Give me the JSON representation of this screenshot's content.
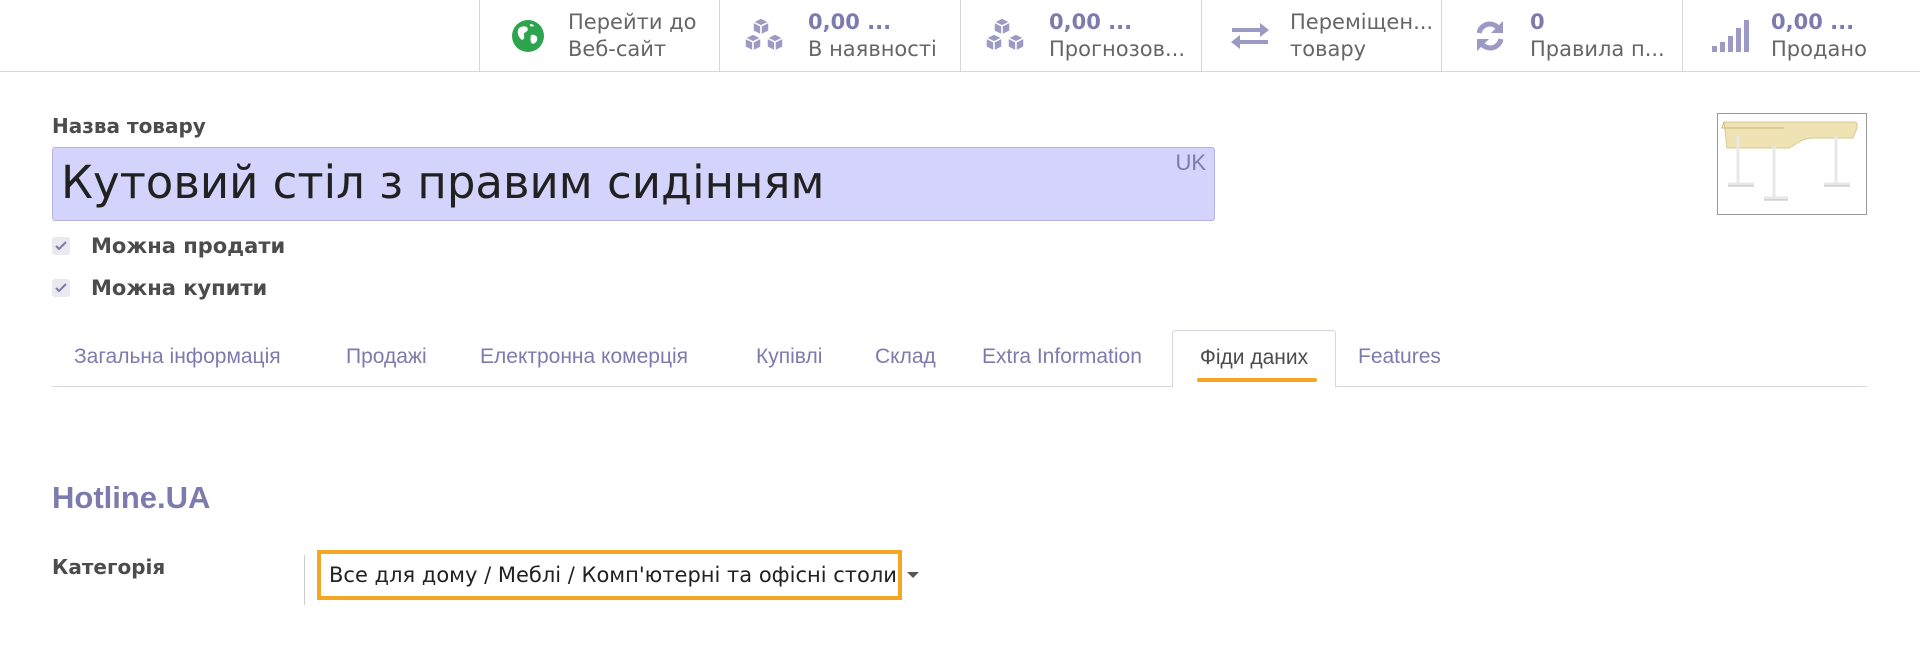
{
  "smart_buttons": [
    {
      "icon": "globe-icon",
      "line1": "Перейти до",
      "line2": "Веб-сайт",
      "numeric": false
    },
    {
      "icon": "cubes-icon",
      "line1": "0,00 ...",
      "line2": "В наявності",
      "numeric": true
    },
    {
      "icon": "cubes-icon",
      "line1": "0,00 ...",
      "line2": "Прогнозов...",
      "numeric": true
    },
    {
      "icon": "exchange-arrows-icon",
      "line1": "Переміщен...",
      "line2": "товару",
      "numeric": false
    },
    {
      "icon": "refresh-icon",
      "line1": "0",
      "line2": "Правила п...",
      "numeric": true
    },
    {
      "icon": "signal-bars-icon",
      "line1": "0,00 ...",
      "line2": "Продано",
      "numeric": true
    }
  ],
  "product": {
    "name_label": "Назва товару",
    "name_value": "Кутовий стіл з правим сидінням",
    "lang": "UK",
    "can_be_sold_label": "Можна продати",
    "can_be_purchased_label": "Можна купити"
  },
  "tabs": [
    {
      "label": "Загальна інформація"
    },
    {
      "label": "Продажі"
    },
    {
      "label": "Електронна комерція"
    },
    {
      "label": "Купівлі"
    },
    {
      "label": "Склад"
    },
    {
      "label": "Extra Information"
    },
    {
      "label": "Фіди даних",
      "active": true
    },
    {
      "label": "Features"
    }
  ],
  "hotline": {
    "title": "Hotline.UA",
    "category_label": "Категорія",
    "category_value": "Все для дому / Меблі / Комп'ютерні та офісні столи"
  },
  "colors": {
    "accent": "#7c7bad",
    "highlight": "#f5a623",
    "input_bg": "#d4d3fb"
  }
}
